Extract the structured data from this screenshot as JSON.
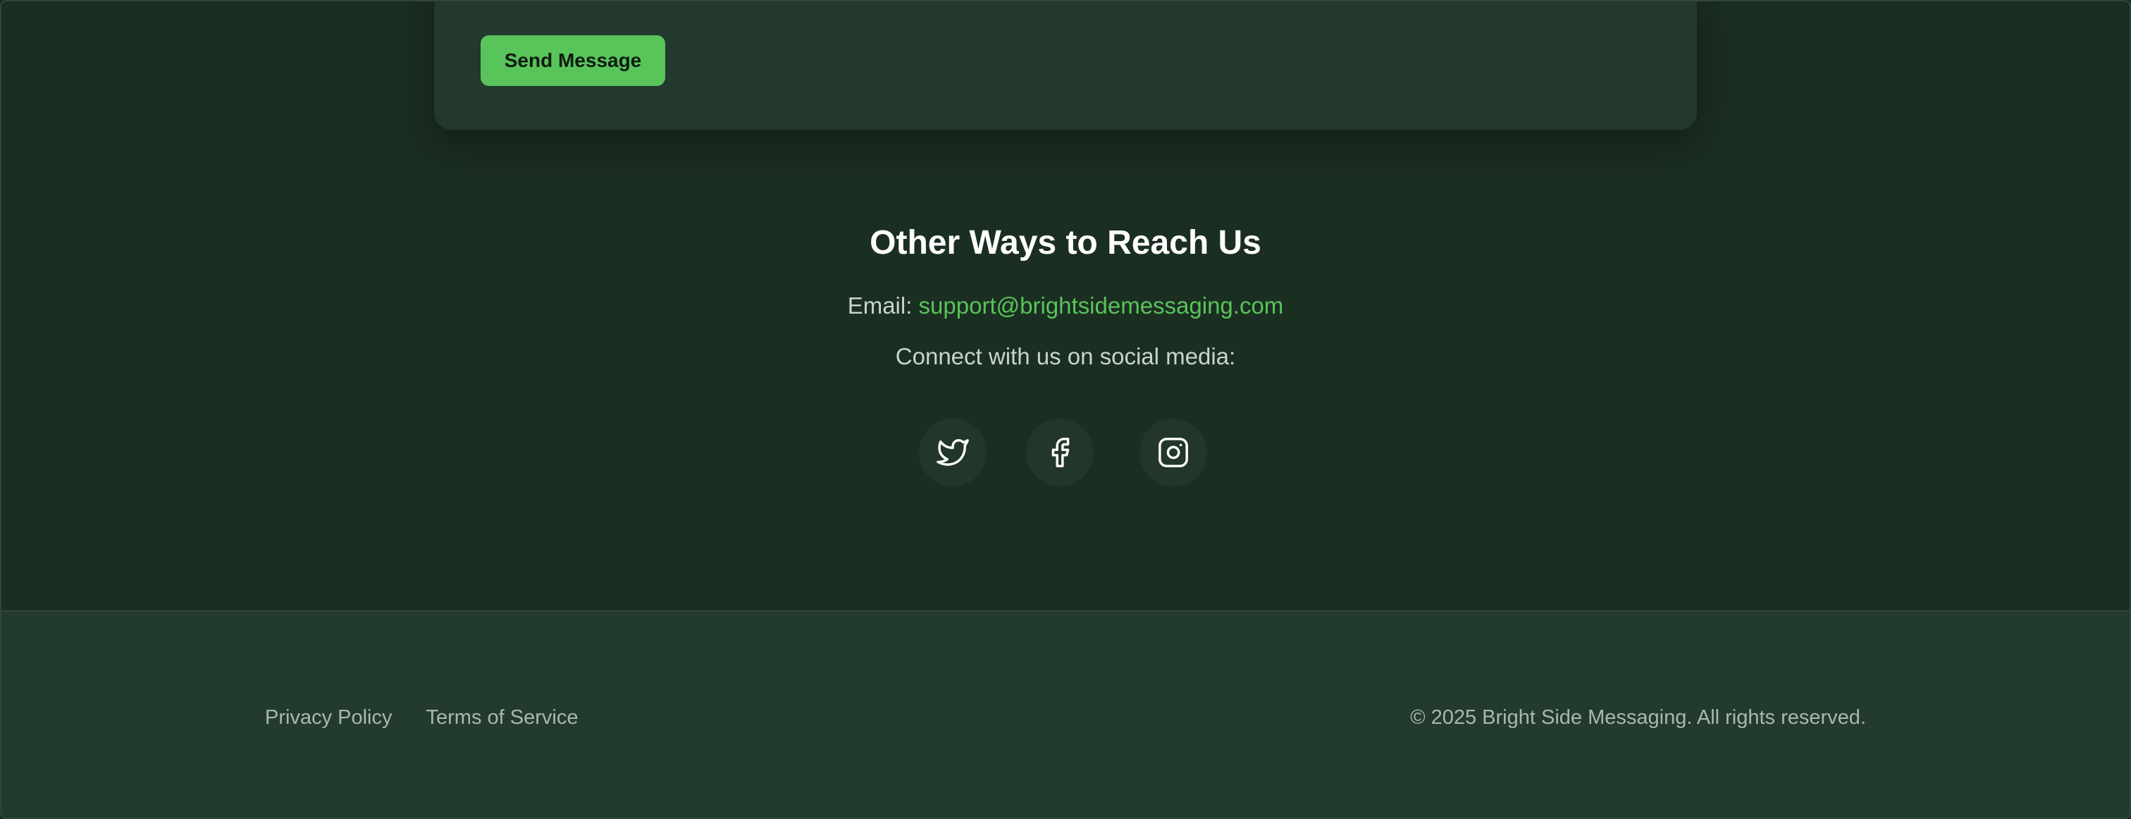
{
  "form": {
    "send_label": "Send Message"
  },
  "reach": {
    "title": "Other Ways to Reach Us",
    "email_label": "Email:",
    "email_value": "support@brightsidemessaging.com",
    "social_text": "Connect with us on social media:",
    "social": [
      {
        "icon": "twitter-icon"
      },
      {
        "icon": "facebook-icon"
      },
      {
        "icon": "instagram-icon"
      }
    ]
  },
  "footer": {
    "links": [
      "Privacy Policy",
      "Terms of Service"
    ],
    "copyright": "© 2025 Bright Side Messaging. All rights reserved."
  },
  "colors": {
    "background": "#1b2e22",
    "card": "#22392b",
    "accent": "#58c45a",
    "footer": "#223b2c"
  }
}
